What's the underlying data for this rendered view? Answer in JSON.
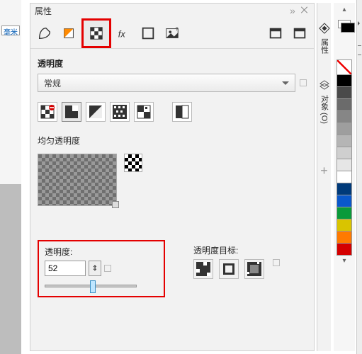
{
  "ruler_unit": "毫米",
  "panel": {
    "title": "属性",
    "section_transparency": "透明度",
    "blend_mode": "常规",
    "uniform_label": "均匀透明度",
    "transparency_label": "透明度:",
    "transparency_value": "52",
    "target_label": "透明度目标:",
    "slider_percent": 52
  },
  "dock": {
    "tab_properties": "属性",
    "tab_objects": "对象 (O)"
  },
  "swatches": {
    "colors": [
      "#000000",
      "#4a4a4a",
      "#6b6b6b",
      "#868686",
      "#9e9e9e",
      "#b5b5b5",
      "#cfcfcf",
      "#e6e6e6",
      "#ffffff",
      "#003a7a",
      "#0a58ca",
      "#0a9a3a",
      "#d9c400",
      "#ff7a00",
      "#d40000"
    ]
  }
}
